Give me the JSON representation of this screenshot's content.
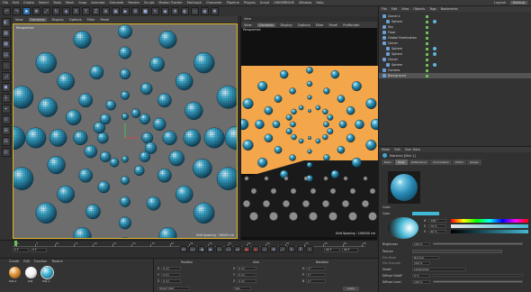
{
  "app": {
    "menus": [
      "File",
      "Edit",
      "Create",
      "Select",
      "Tools",
      "Mesh",
      "Snap",
      "Animate",
      "Simulate",
      "Render",
      "Sculpt",
      "Motion Tracker",
      "MoGraph",
      "Character",
      "Pipeline",
      "Plugins",
      "Script",
      "VRAYBRIDGE",
      "Window",
      "Help"
    ],
    "layout_label": "Layout:",
    "layout_value": "Startup"
  },
  "viewport1": {
    "menus": [
      "View",
      "Cameras",
      "Display",
      "Options",
      "Filter",
      "Panel"
    ],
    "name": "Perspective",
    "grid_spacing": "Grid Spacing : 10000 cm"
  },
  "viewport2": {
    "tab_label": "View",
    "menus": [
      "View",
      "Cameras",
      "Display",
      "Options",
      "Filter",
      "Panel",
      "ProRender"
    ],
    "name": "Perspective",
    "grid_spacing": "Grid Spacing : 100000 cm"
  },
  "object_manager": {
    "tabs": [
      "File",
      "Edit",
      "View",
      "Objects",
      "Tags",
      "Bookmarks"
    ],
    "objects": [
      {
        "name": "Cloner.1",
        "level": 0,
        "selected": false
      },
      {
        "name": "Sphere",
        "level": 1,
        "selected": false
      },
      {
        "name": "Sky",
        "level": 0,
        "selected": false
      },
      {
        "name": "Floor",
        "level": 0,
        "selected": false
      },
      {
        "name": "Global Illumination",
        "level": 0,
        "selected": false
      },
      {
        "name": "Cloner",
        "level": 0,
        "selected": false
      },
      {
        "name": "Sphere",
        "level": 1,
        "selected": false
      },
      {
        "name": "Sphere",
        "level": 1,
        "selected": false
      },
      {
        "name": "Cloner",
        "level": 0,
        "selected": false
      },
      {
        "name": "Sphere",
        "level": 1,
        "selected": false
      },
      {
        "name": "Camera",
        "level": 0,
        "selected": false
      },
      {
        "name": "Background",
        "level": 0,
        "selected": true
      }
    ]
  },
  "attribute_manager": {
    "menus": [
      "Mode",
      "Edit",
      "User Data"
    ],
    "title": "Material [Mat.1]",
    "tabs": [
      "Basic",
      "Color",
      "Reflectance",
      "Illumination",
      "Editor",
      "Assign"
    ],
    "active_tab": "Color",
    "section_color": "Color",
    "color_label": "Color",
    "h_label": "H",
    "h_value": "198 °",
    "s_label": "S",
    "s_value": "79 %",
    "v_label": "V",
    "v_value": "90 %",
    "brightness_label": "Brightness",
    "brightness_value": "100 %",
    "texture_label": "Texture",
    "mix_mode_label": "Mix Mode",
    "mix_mode_value": "Normal",
    "mix_strength_label": "Mix Strength",
    "mix_strength_value": "100 %",
    "model_label": "Model",
    "model_value": "Lambertian",
    "diffuse_falloff_label": "Diffuse Falloff",
    "diffuse_falloff_value": "0 %",
    "diffuse_level_label": "Diffuse Level",
    "diffuse_level_value": "100 %",
    "material_color": "#43b8d6"
  },
  "timeline": {
    "ticks": [
      "0",
      "5",
      "10",
      "15",
      "20",
      "25",
      "30",
      "35",
      "40",
      "45",
      "50",
      "55",
      "60",
      "65",
      "70",
      "75",
      "80",
      "85",
      "90"
    ],
    "start_frame": "0 F",
    "current_frame": "0 F",
    "end_frame": "90 F",
    "max_frame": "90 F"
  },
  "material_manager": {
    "menus": [
      "Create",
      "Edit",
      "Function",
      "Texture"
    ],
    "materials": [
      {
        "name": "Mat.2",
        "color": "#e39a3d"
      },
      {
        "name": "Mat",
        "color": "#ffffff"
      },
      {
        "name": "Mat.1",
        "color": "#43b8d6"
      }
    ]
  },
  "coordinate_manager": {
    "columns": [
      "Position",
      "Size",
      "Rotation"
    ],
    "rows": [
      {
        "axis": "X",
        "pos": "0 cm",
        "size": "0 cm",
        "rot_label": "H",
        "rot": "0 °"
      },
      {
        "axis": "Y",
        "pos": "0 cm",
        "size": "0 cm",
        "rot_label": "P",
        "rot": "0 °"
      },
      {
        "axis": "Z",
        "pos": "0 cm",
        "size": "0 cm",
        "rot_label": "B",
        "rot": "0 °"
      }
    ],
    "mode_left": "Object (Rel)",
    "mode_right": "Size",
    "apply_label": "Apply"
  }
}
